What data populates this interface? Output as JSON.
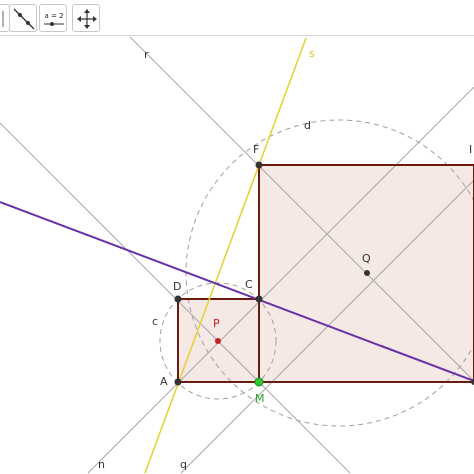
{
  "toolbar": {
    "tools": [
      {
        "name": "select-tool",
        "icon": "partial-tool-icon"
      },
      {
        "name": "line-tool",
        "icon": "line-through-two-points-icon"
      },
      {
        "name": "slider-tool",
        "icon": "slider-icon",
        "label": "a = 2"
      },
      {
        "name": "move-view-tool",
        "icon": "move-graphics-view-icon"
      }
    ]
  },
  "labels": {
    "r": "r",
    "s": "s",
    "d": "d",
    "F": "F",
    "I": "I",
    "Q": "Q",
    "C": "C",
    "D": "D",
    "P": "P",
    "c": "c",
    "A": "A",
    "M": "M",
    "n": "n",
    "q": "q"
  },
  "colors": {
    "square_stroke": "#6b1a10",
    "square_fill": "#f5e9e6",
    "purple_line": "#6a30a8",
    "yellow_line": "#e6cf2e",
    "gray_line": "#a8a8a8",
    "dashed_circle": "#a0a0a0",
    "point": "#333333",
    "point_P": "#c62020",
    "point_M": "#32c832"
  }
}
